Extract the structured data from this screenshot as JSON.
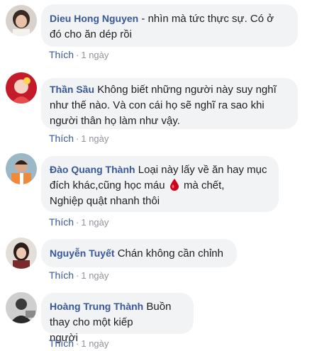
{
  "comments": [
    {
      "author": "Dieu Hong Nguyen",
      "text_lines": [
        "- nhìn mà tức thực sự. Có ở",
        "đó cho ăn dép rồi"
      ],
      "like_label": "Thích",
      "separator": "·",
      "time": "1 ngày"
    },
    {
      "author": "Thần Sầu",
      "text_lines": [
        "Không biết những người này suy nghĩ",
        "như thế nào. Và con cái họ sẽ nghĩ ra sao khi",
        "người thân họ làm như vậy."
      ],
      "like_label": "Thích",
      "separator": "·",
      "time": "1 ngày"
    },
    {
      "author": "Đào Quang Thành",
      "text_lines": [
        "Loại này lấy về ăn hay mục",
        "đích khác,cũng học máu",
        "mà chết,",
        "Nghiệp quật nhanh thôi"
      ],
      "emoji": "blood-drop-icon",
      "like_label": "Thích",
      "separator": "·",
      "time": "1 ngày"
    },
    {
      "author": "Nguyễn Tuyết",
      "text_lines": [
        "Chán không cần chỉnh"
      ],
      "like_label": "Thích",
      "separator": "·",
      "time": "1 ngày"
    },
    {
      "author": "Hoàng Trung Thành",
      "text_lines": [
        "Buồn thay cho một kiếp",
        "người"
      ],
      "like_label": "Thích",
      "separator": "·",
      "time": "1 ngày"
    }
  ],
  "colors": {
    "author": "#385898",
    "bubble": "#f2f3f5",
    "time": "#90949c",
    "blood": "#d0021b"
  }
}
